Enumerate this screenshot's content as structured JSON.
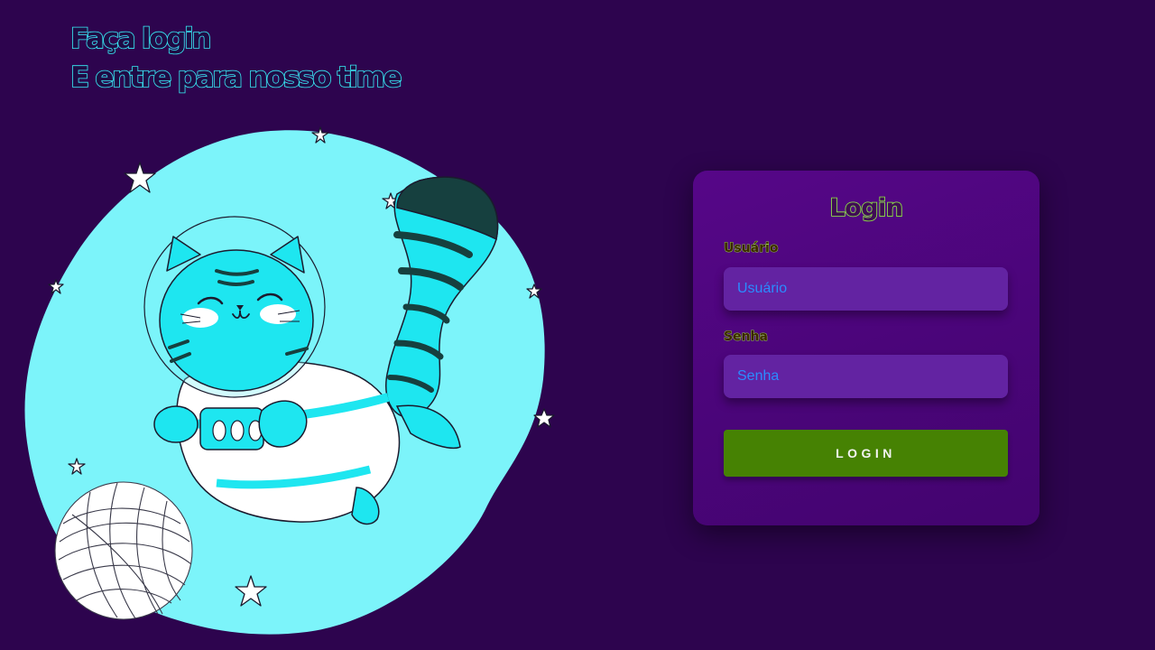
{
  "hero": {
    "line1": "Faça login",
    "line2": "E entre para nosso time"
  },
  "login": {
    "title": "Login",
    "username_label": "Usuário",
    "username_placeholder": "Usuário",
    "password_label": "Senha",
    "password_placeholder": "Senha",
    "button_label": "LOGIN"
  },
  "colors": {
    "background": "#2d044e",
    "hero_outline": "#38eef6",
    "blob": "#7cf4fa",
    "cat": "#1ee6f0",
    "card": "#4f0680",
    "label_outline": "#9ff23f",
    "input_background": "#6323a2",
    "input_text": "#2a8cff",
    "button": "#468203"
  },
  "illustration": {
    "subject": "astronaut-cat"
  }
}
